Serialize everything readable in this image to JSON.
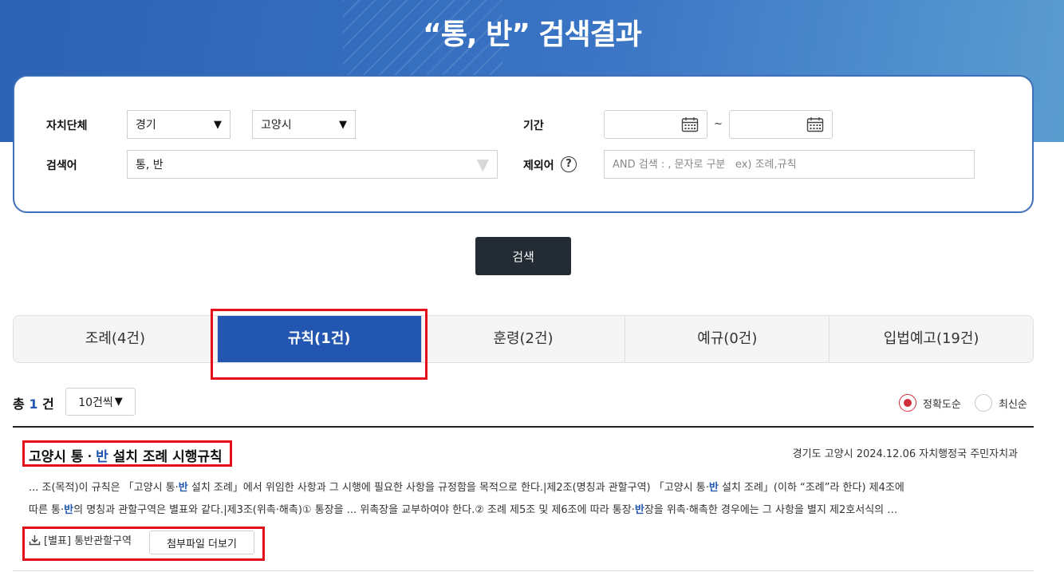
{
  "banner": {
    "title": "“통, 반” 검색결과"
  },
  "search_form": {
    "region_label": "자치단체",
    "province_value": "경기",
    "city_value": "고양시",
    "period_label": "기간",
    "date_from": "",
    "date_to": "",
    "date_separator": "~",
    "keyword_label": "검색어",
    "keyword_value": "통, 반",
    "exclude_label": "제외어",
    "exclude_help": "?",
    "exclude_placeholder": "AND 검색 : , 문자로 구분   ex) 조례,규칙",
    "search_button": "검색"
  },
  "tabs": [
    {
      "label": "조례(4건)",
      "active": false
    },
    {
      "label": "규칙(1건)",
      "active": true
    },
    {
      "label": "훈령(2건)",
      "active": false
    },
    {
      "label": "예규(0건)",
      "active": false
    },
    {
      "label": "입법예고(19건)",
      "active": false
    }
  ],
  "results_header": {
    "total_prefix": "총",
    "total_count": "1",
    "total_suffix": "건",
    "per_page": "10건씩",
    "sort_options": [
      {
        "label": "정확도순",
        "selected": true
      },
      {
        "label": "최신순",
        "selected": false
      }
    ]
  },
  "result": {
    "title_part1": "고양시 통ㆍ",
    "title_hl": "반",
    "title_part2": " 설치 조례 시행규칙",
    "meta": "경기도 고양시 2024.12.06 자치행정국 주민자치과",
    "snippet_1a": "... 조(목적)이 규칙은 「고양시 통·",
    "snippet_1b": "반",
    "snippet_1c": " 설치 조례」에서 위임한 사항과 그 시행에 필요한 사항을 규정함을 목적으로 한다.|제2조(명칭과 관할구역) 「고양시 통·",
    "snippet_1d": "반",
    "snippet_1e": " 설치 조례」(이하 “조례”라 한다) 제4조에",
    "snippet_2a": "따른 통·",
    "snippet_2b": "반",
    "snippet_2c": "의 명칭과 관할구역은 별표와 같다.|제3조(위촉·해촉)① 통장을 ... 위촉장을 교부하여야 한다.② 조례 제5조 및 제6조에 따라 통장·",
    "snippet_2d": "반",
    "snippet_2e": "장을 위촉·해촉한 경우에는 그 사항을 별지 제2호서식의 …",
    "attachment": "[별표] 통반관할구역",
    "more_button": "첨부파일 더보기"
  },
  "colors": {
    "banner": "#3a74c4",
    "active_tab": "#2256b0",
    "highlight": "#2256b0",
    "annotation_box": "#e3101b",
    "search_button": "#232b35",
    "radio_selected": "#d0303b"
  }
}
